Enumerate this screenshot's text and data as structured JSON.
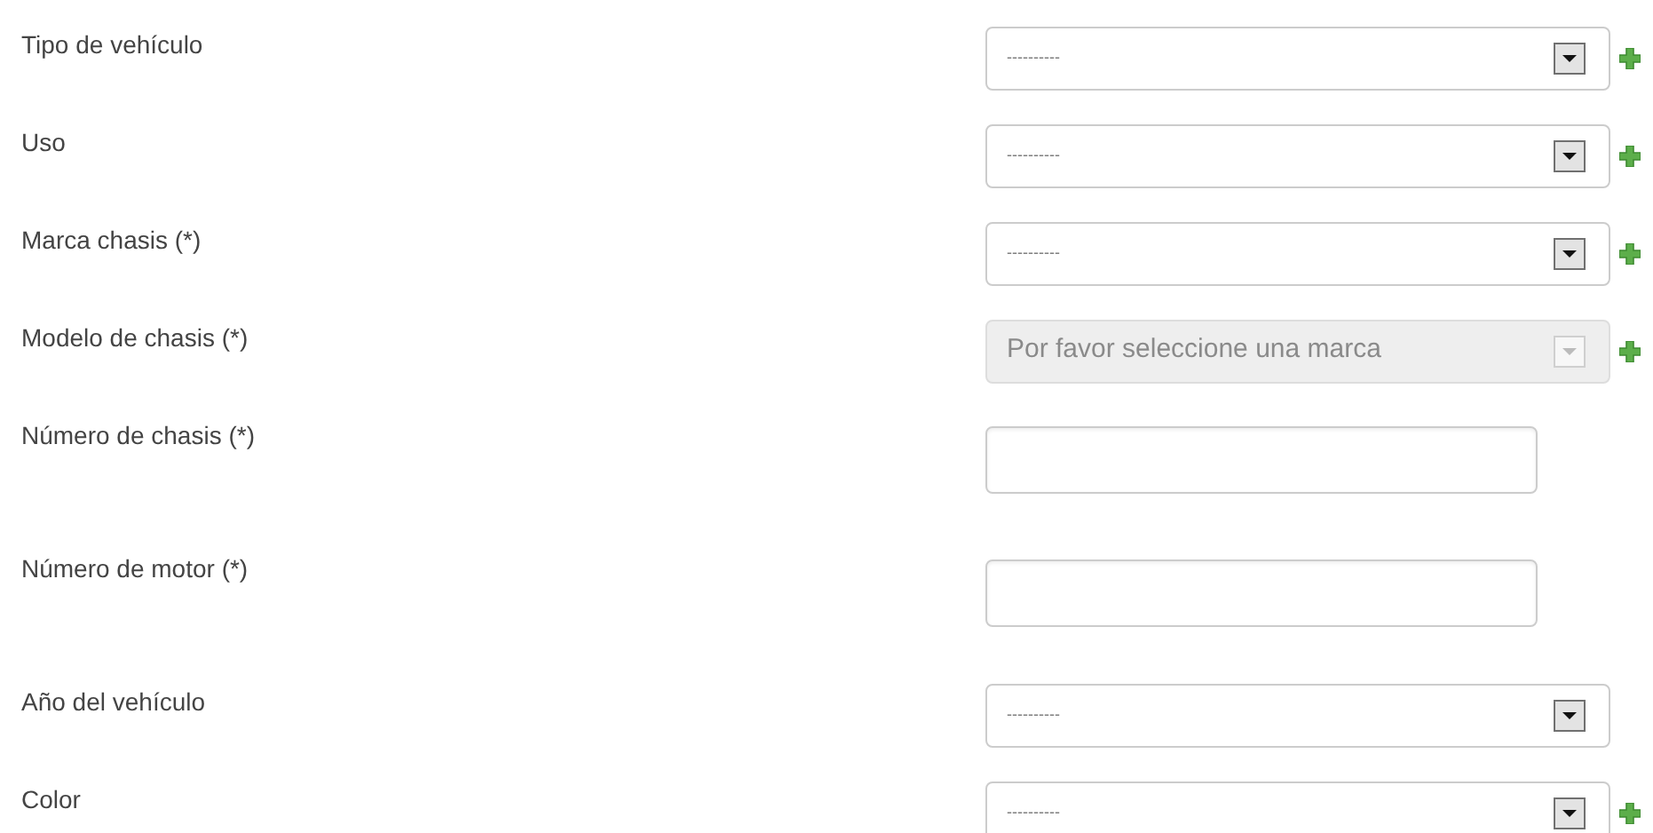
{
  "fields": [
    {
      "label": "Tipo de vehículo",
      "kind": "select",
      "value": "----------",
      "disabled": false,
      "add_button": true
    },
    {
      "label": "Uso",
      "kind": "select",
      "value": "----------",
      "disabled": false,
      "add_button": true
    },
    {
      "label": "Marca chasis (*)",
      "kind": "select",
      "value": "----------",
      "disabled": false,
      "add_button": true
    },
    {
      "label": "Modelo de chasis (*)",
      "kind": "select",
      "value": "Por favor seleccione una marca",
      "disabled": true,
      "add_button": true
    },
    {
      "label": "Número de chasis (*)",
      "kind": "text"
    },
    {
      "label": "Número de motor (*)",
      "kind": "text"
    },
    {
      "label": "Año del vehículo",
      "kind": "select",
      "value": "----------",
      "disabled": false,
      "add_button": false
    },
    {
      "label": "Color",
      "kind": "select",
      "value": "----------",
      "disabled": false,
      "add_button": true
    }
  ]
}
